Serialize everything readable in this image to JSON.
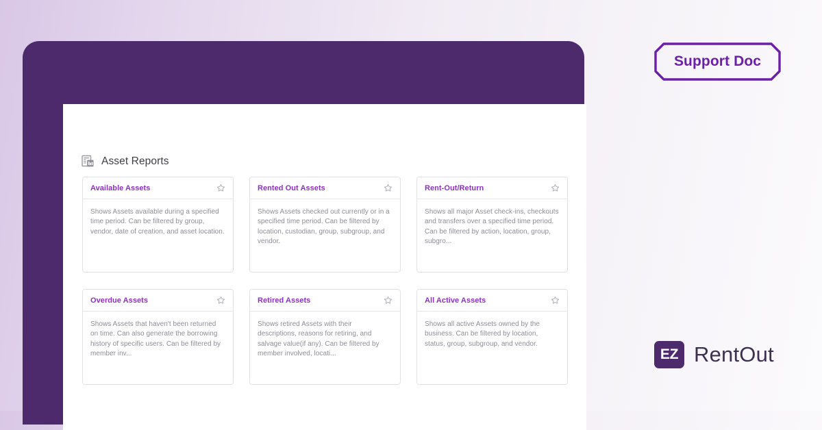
{
  "badge": {
    "label": "Support Doc",
    "border_color": "#6c1fa8"
  },
  "brand": {
    "mark": "EZ",
    "word": "RentOut",
    "mark_bg": "#4c2a6b"
  },
  "app": {
    "frame_color": "#4c2a6b",
    "panel_bg": "#ffffff",
    "heading": {
      "icon": "report-document-icon",
      "title": "Asset Reports"
    },
    "accent_color": "#8f2fc4",
    "cards": [
      {
        "title": "Available Assets",
        "description": "Shows Assets available during a specified time period. Can be filtered by group, vendor, date of creation, and asset location.",
        "favorite_icon": "star-outline-icon",
        "favorited": false
      },
      {
        "title": "Rented Out Assets",
        "description": "Shows Assets checked out currently or in a specified time period. Can be filtered by location, custodian, group, subgroup, and vendor.",
        "favorite_icon": "star-outline-icon",
        "favorited": false
      },
      {
        "title": "Rent-Out/Return",
        "description": "Shows all major Asset check-ins, checkouts and transfers over a specified time period. Can be filtered by action, location, group, subgro...",
        "favorite_icon": "star-outline-icon",
        "favorited": false
      },
      {
        "title": "Overdue Assets",
        "description": "Shows Assets that haven't been returned on time. Can also generate the borrowing history of specific users. Can be filtered by member inv...",
        "favorite_icon": "star-outline-icon",
        "favorited": false
      },
      {
        "title": "Retired Assets",
        "description": "Shows retired Assets with their descriptions, reasons for retiring, and salvage value(if any). Can be filtered by member involved, locati...",
        "favorite_icon": "star-outline-icon",
        "favorited": false
      },
      {
        "title": "All Active Assets",
        "description": "Shows all active Assets owned by the business. Can be filtered by location, status, group, subgroup, and vendor.",
        "favorite_icon": "star-outline-icon",
        "favorited": false
      }
    ]
  }
}
